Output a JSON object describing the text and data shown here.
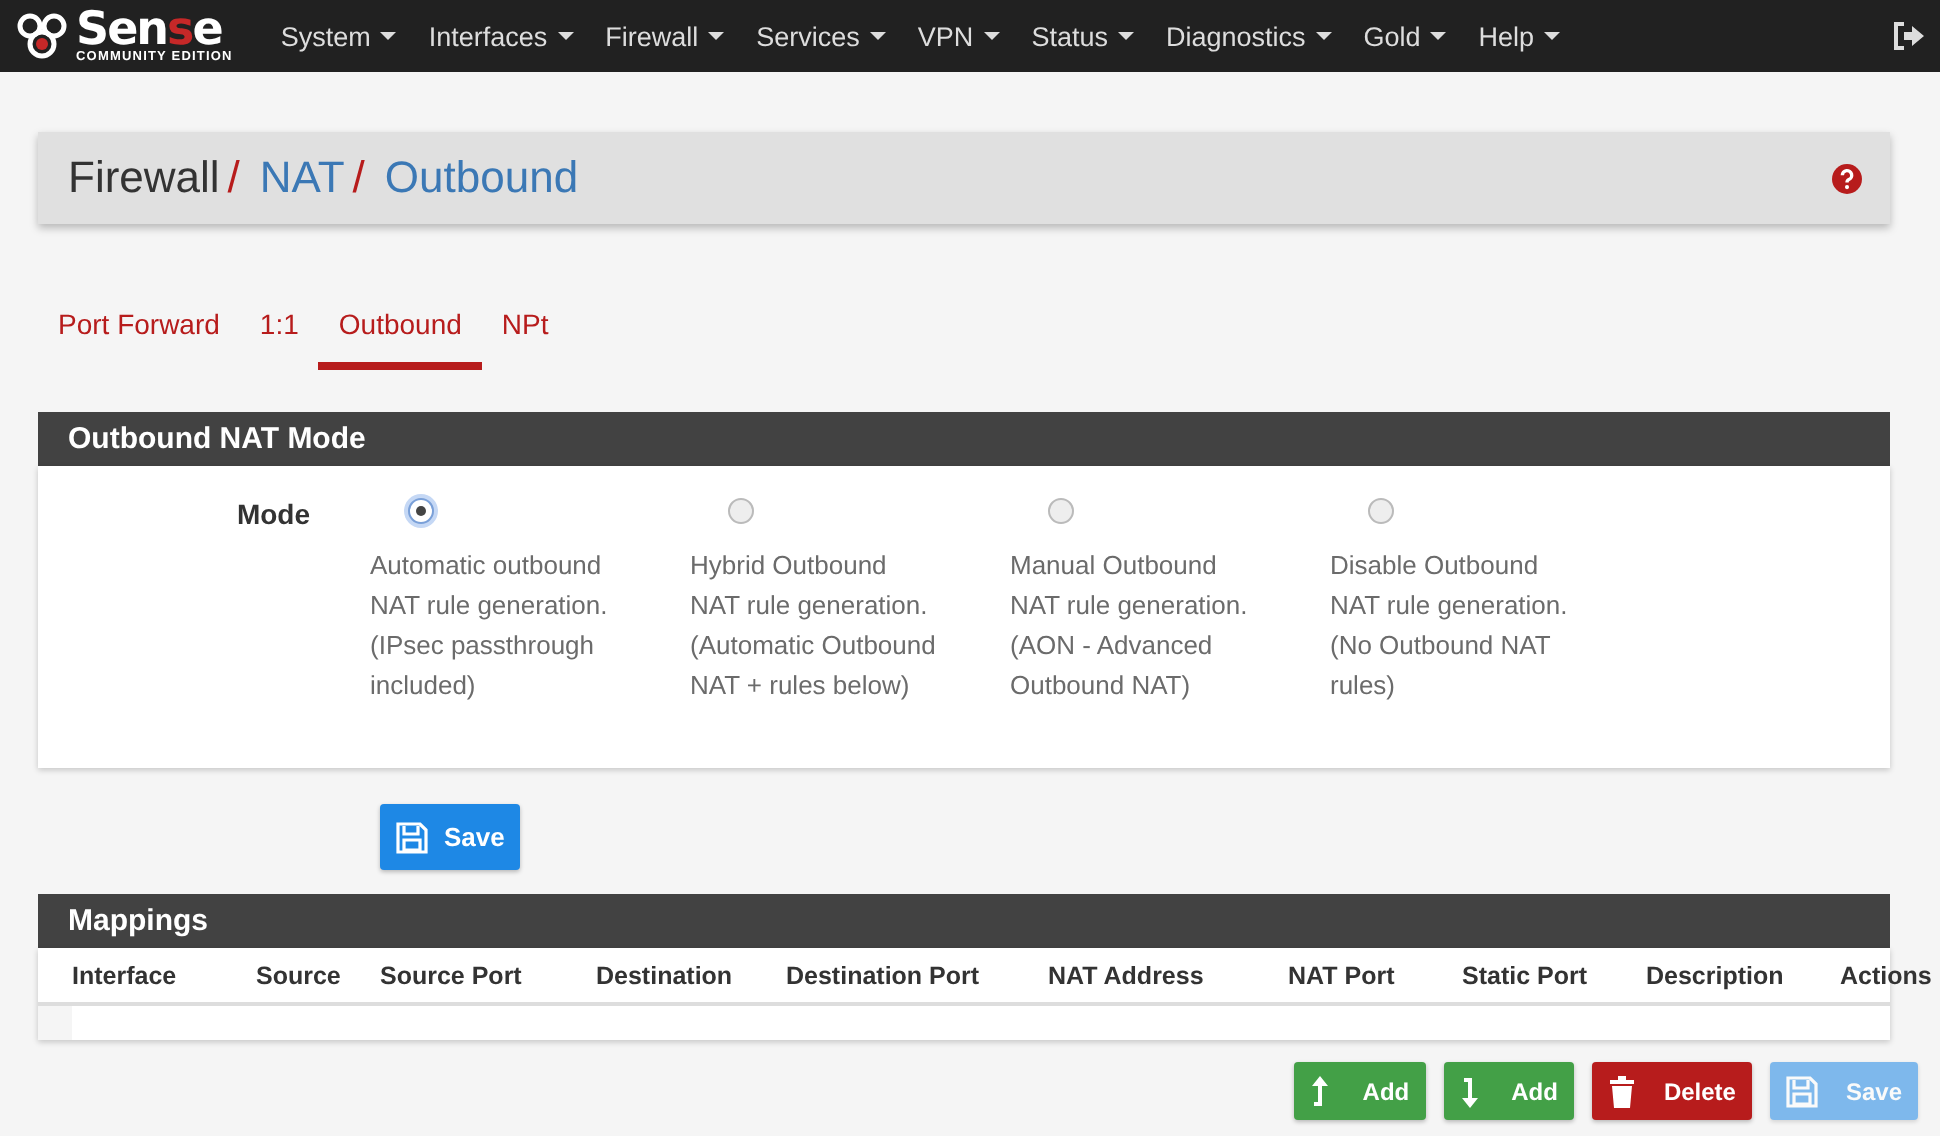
{
  "navbar": {
    "logo": {
      "parts": [
        {
          "text": "Sen",
          "accent": false
        },
        {
          "text": "s",
          "accent": true
        },
        {
          "text": "e",
          "accent": false
        }
      ],
      "edition": "COMMUNITY EDITION"
    },
    "menus": [
      {
        "label": "System"
      },
      {
        "label": "Interfaces"
      },
      {
        "label": "Firewall"
      },
      {
        "label": "Services"
      },
      {
        "label": "VPN"
      },
      {
        "label": "Status"
      },
      {
        "label": "Diagnostics"
      },
      {
        "label": "Gold"
      },
      {
        "label": "Help"
      }
    ]
  },
  "breadcrumb": [
    {
      "label": "Firewall",
      "link": false,
      "separator": "/"
    },
    {
      "label": "NAT",
      "link": true,
      "separator": "/"
    },
    {
      "label": "Outbound",
      "link": true
    }
  ],
  "tabs": [
    {
      "label": "Port Forward",
      "selected": false
    },
    {
      "label": "1:1",
      "selected": false
    },
    {
      "label": "Outbound",
      "selected": true
    },
    {
      "label": "NPt",
      "selected": false
    }
  ],
  "mode_panel": {
    "title": "Outbound NAT Mode",
    "label": "Mode",
    "options": [
      {
        "text": "Automatic outbound NAT rule generation. (IPsec passthrough included)",
        "selected": true
      },
      {
        "text": "Hybrid Outbound NAT rule generation. (Automatic Outbound NAT + rules below)",
        "selected": false
      },
      {
        "text": "Manual Outbound NAT rule generation. (AON - Advanced Outbound NAT)",
        "selected": false
      },
      {
        "text": "Disable Outbound NAT rule generation. (No Outbound NAT rules)",
        "selected": false
      }
    ],
    "save": "Save"
  },
  "mappings": {
    "title": "Mappings",
    "columns": [
      "Interface",
      "Source",
      "Source Port",
      "Destination",
      "Destination Port",
      "NAT Address",
      "NAT Port",
      "Static Port",
      "Description",
      "Actions"
    ]
  },
  "actions": [
    {
      "kind": "add-top",
      "label": "Add",
      "disabled": false
    },
    {
      "kind": "add-bottom",
      "label": "Add",
      "disabled": false
    },
    {
      "kind": "delete",
      "label": "Delete",
      "disabled": false
    },
    {
      "kind": "save",
      "label": "Save",
      "disabled": true
    }
  ]
}
